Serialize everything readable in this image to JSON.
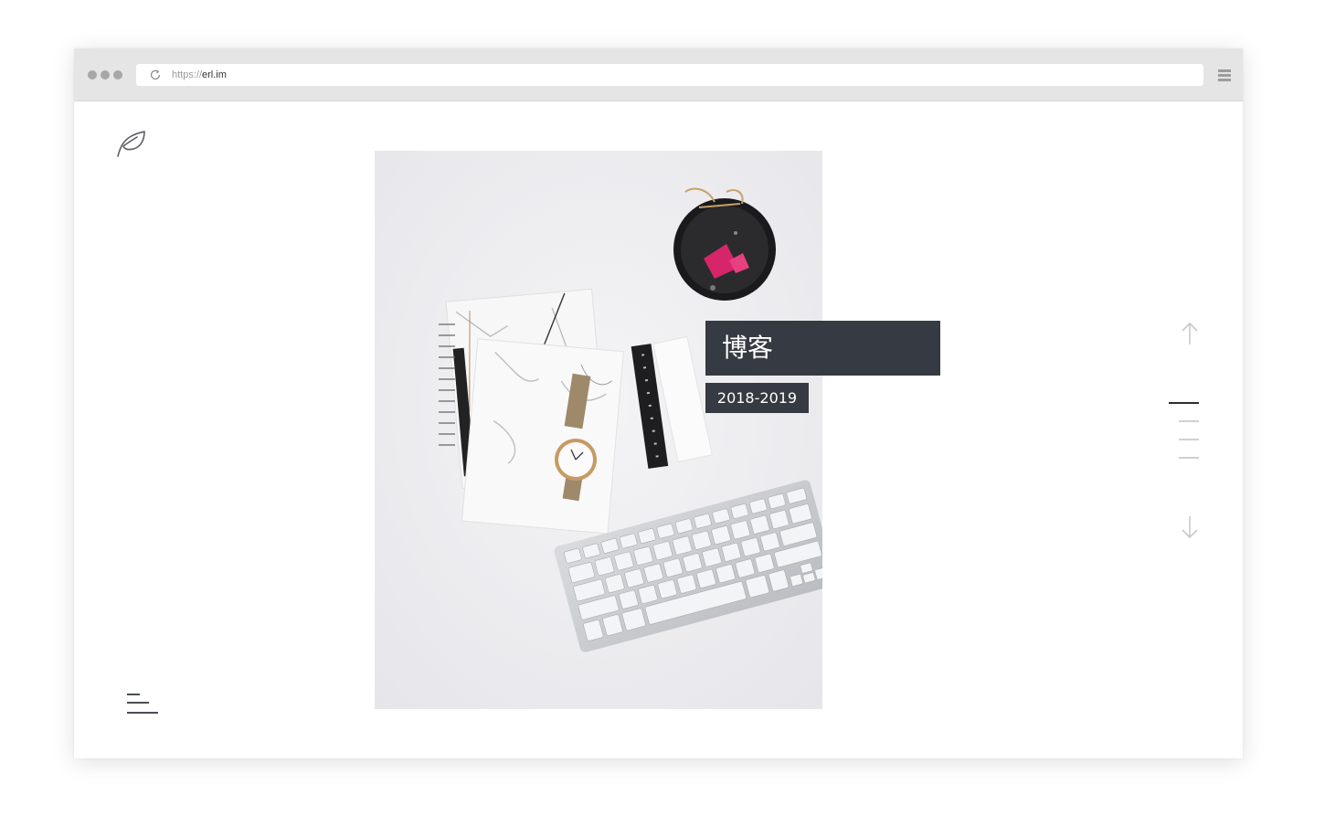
{
  "browser": {
    "url_protocol": "https://",
    "url_host": "erl.im"
  },
  "icons": {
    "logo": "leaf-icon",
    "reload": "reload-icon",
    "browser_menu": "hamburger-menu-icon",
    "nav_menu": "menu-lines-icon",
    "prev": "arrow-up-icon",
    "next": "arrow-down-icon"
  },
  "slide": {
    "title": "博客",
    "years": "2018-2019",
    "image_subject": "desk flat lay with marble notebooks, watch, ruler, keyboard and clip tray"
  },
  "pager": {
    "count": 4,
    "active_index": 0
  },
  "colors": {
    "label_bg": "#363a42",
    "chrome_bg": "#e5e5e5",
    "pager_active": "#2c2e33",
    "pager_inactive": "#d0d0d4"
  }
}
